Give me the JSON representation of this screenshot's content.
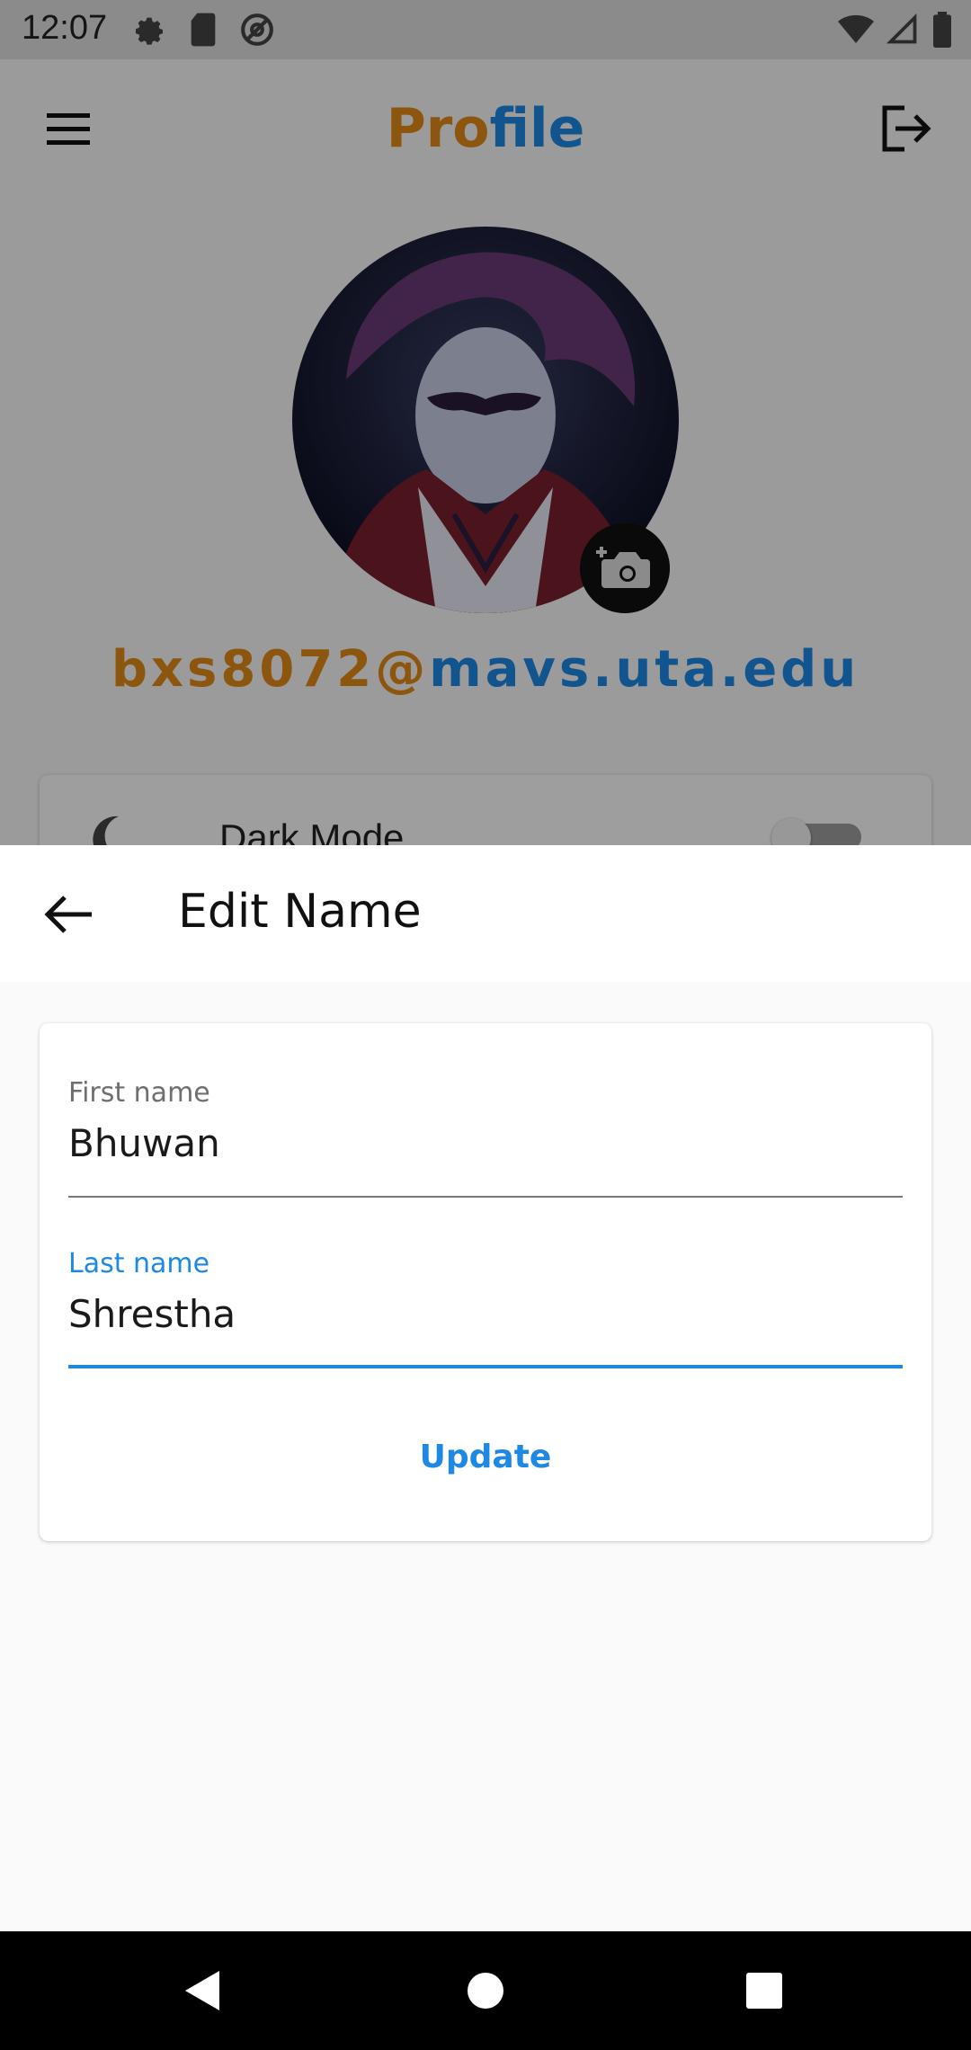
{
  "status_bar": {
    "time": "12:07",
    "icons_left": [
      "settings-icon",
      "sd-card-icon",
      "at-sign-icon"
    ],
    "icons_right": [
      "wifi-icon",
      "cell-signal-icon",
      "battery-icon"
    ]
  },
  "profile": {
    "title_part1": "Pro",
    "title_part2": "file",
    "email_part1": "bxs8072@",
    "email_part2": "mavs.uta.edu",
    "dark_mode_label": "Dark Mode",
    "dark_mode_on": false
  },
  "sheet": {
    "title": "Edit Name",
    "first_name": {
      "label": "First name",
      "value": "Bhuwan"
    },
    "last_name": {
      "label": "Last name",
      "value": "Shrestha"
    },
    "update_label": "Update"
  },
  "colors": {
    "accent_blue": "#1e88e5",
    "accent_orange": "#e38b17"
  }
}
